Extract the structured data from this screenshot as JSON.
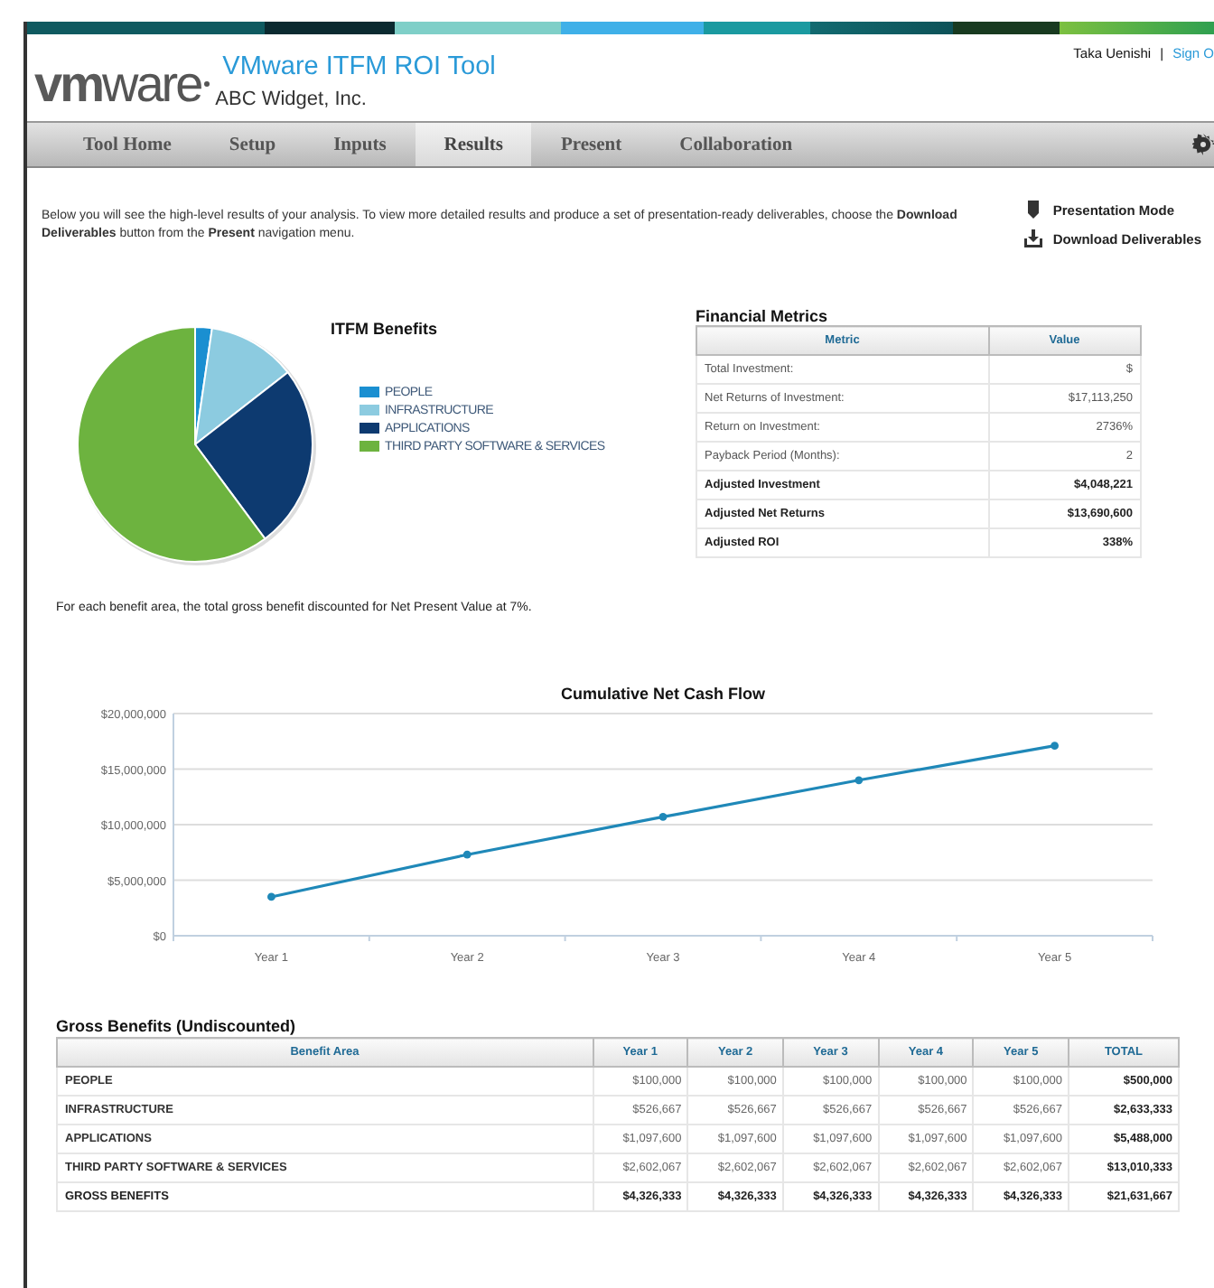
{
  "header": {
    "logo": "**vm**ware",
    "app_title": "VMware ITFM ROI Tool",
    "company": "ABC Widget, Inc.",
    "user": "Taka Uenishi",
    "separator": "|",
    "sign_out": "Sign O"
  },
  "nav": {
    "tabs": [
      {
        "label": "Tool Home",
        "selected": false
      },
      {
        "label": "Setup",
        "selected": false
      },
      {
        "label": "Inputs",
        "selected": false
      },
      {
        "label": "Results",
        "selected": true
      },
      {
        "label": "Present",
        "selected": false
      },
      {
        "label": "Collaboration",
        "selected": false
      }
    ]
  },
  "intro": {
    "text": "Below you will see the high-level results of your analysis. To view more detailed results and produce a set of presentation-ready deliverables, choose the **Download Deliverables** button from the **Present** navigation menu.",
    "actions": [
      {
        "kind": "presentation",
        "label": "Presentation Mode"
      },
      {
        "kind": "download",
        "label": "Download Deliverables"
      }
    ]
  },
  "benefits_chart": {
    "chart_data": {
      "type": "pie",
      "title": "ITFM Benefits",
      "categories": [
        "PEOPLE",
        "INFRASTRUCTURE",
        "APPLICATIONS",
        "THIRD PARTY SOFTWARE & SERVICES"
      ],
      "legend": true,
      "series": [
        {
          "colors": [
            "#1a8fd1",
            "#8ccbe0",
            "#0d3a70",
            "#6db33f"
          ],
          "values": [
            2.31,
            12.17,
            25.37,
            60.15
          ]
        }
      ]
    }
  },
  "financial_metrics": {
    "title": "Financial Metrics",
    "columns": [
      "Metric",
      "Value"
    ],
    "rows": [
      {
        "metric": "Total Investment:",
        "value": "$",
        "emphasis": false
      },
      {
        "metric": "Net Returns of Investment:",
        "value": "$17,113,250",
        "emphasis": false
      },
      {
        "metric": "Return on Investment:",
        "value": "2736%",
        "emphasis": false
      },
      {
        "metric": "Payback Period (Months):",
        "value": "2",
        "emphasis": false
      },
      {
        "metric": "Adjusted Investment",
        "value": "$4,048,221",
        "emphasis": true
      },
      {
        "metric": "Adjusted Net Returns",
        "value": "$13,690,600",
        "emphasis": true
      },
      {
        "metric": "Adjusted ROI",
        "value": "338%",
        "emphasis": true
      }
    ]
  },
  "note": "For each benefit area, the total gross benefit discounted for Net Present Value at 7%.",
  "cash_flow_chart": {
    "chart_data": {
      "type": "line",
      "title": "Cumulative Net Cash Flow",
      "categories": [
        "Year 1",
        "Year 2",
        "Year 3",
        "Year 4",
        "Year 5"
      ],
      "grid": true,
      "series": [
        {
          "color": "#1f88b8",
          "marker": "circle",
          "values": [
            3500000,
            7300000,
            10700000,
            14000000,
            17100000
          ]
        }
      ],
      "ylim": [
        0,
        20000000
      ],
      "yticks": [
        {
          "value": 0,
          "label": "$0"
        },
        {
          "value": 5000000,
          "label": "$5,000,000"
        },
        {
          "value": 10000000,
          "label": "$10,000,000"
        },
        {
          "value": 15000000,
          "label": "$15,000,000"
        },
        {
          "value": 20000000,
          "label": "$20,000,000"
        }
      ]
    }
  },
  "gross_benefits": {
    "title": "Gross Benefits (Undiscounted)",
    "columns": [
      "Benefit Area",
      "Year 1",
      "Year 2",
      "Year 3",
      "Year 4",
      "Year 5",
      "TOTAL"
    ],
    "rows": [
      {
        "total_row": false,
        "cells": [
          "PEOPLE",
          "$100,000",
          "$100,000",
          "$100,000",
          "$100,000",
          "$100,000",
          "$500,000"
        ]
      },
      {
        "total_row": false,
        "cells": [
          "INFRASTRUCTURE",
          "$526,667",
          "$526,667",
          "$526,667",
          "$526,667",
          "$526,667",
          "$2,633,333"
        ]
      },
      {
        "total_row": false,
        "cells": [
          "APPLICATIONS",
          "$1,097,600",
          "$1,097,600",
          "$1,097,600",
          "$1,097,600",
          "$1,097,600",
          "$5,488,000"
        ]
      },
      {
        "total_row": false,
        "cells": [
          "THIRD PARTY SOFTWARE & SERVICES",
          "$2,602,067",
          "$2,602,067",
          "$2,602,067",
          "$2,602,067",
          "$2,602,067",
          "$13,010,333"
        ]
      },
      {
        "total_row": true,
        "cells": [
          "GROSS BENEFITS",
          "$4,326,333",
          "$4,326,333",
          "$4,326,333",
          "$4,326,333",
          "$4,326,333",
          "$21,631,667"
        ]
      }
    ]
  }
}
